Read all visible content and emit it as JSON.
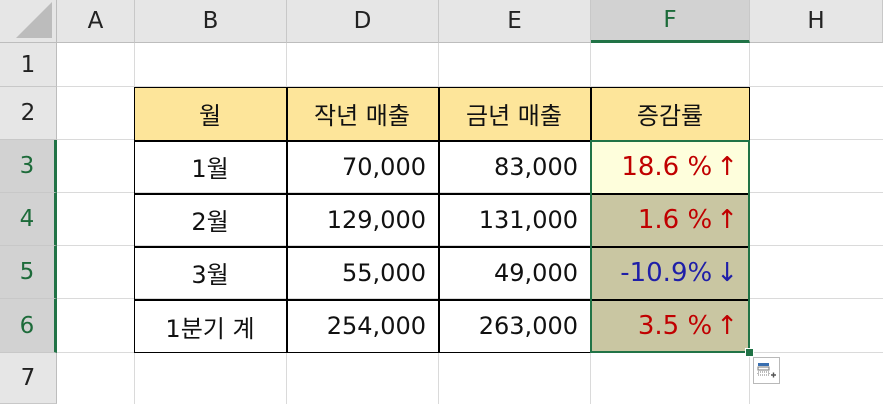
{
  "columns": [
    "A",
    "B",
    "D",
    "E",
    "F",
    "H"
  ],
  "rows": [
    "1",
    "2",
    "3",
    "4",
    "5",
    "6",
    "7"
  ],
  "table": {
    "headers": [
      "월",
      "작년 매출",
      "금년 매출",
      "증감률"
    ],
    "data": [
      {
        "month": "1월",
        "last_year": "70,000",
        "this_year": "83,000",
        "rate": "18.6 %",
        "arrow": "↑"
      },
      {
        "month": "2월",
        "last_year": "129,000",
        "this_year": "131,000",
        "rate": "1.6 %",
        "arrow": "↑"
      },
      {
        "month": "3월",
        "last_year": "55,000",
        "this_year": "49,000",
        "rate": "-10.9%",
        "arrow": "↓"
      },
      {
        "month": "1분기 계",
        "last_year": "254,000",
        "this_year": "263,000",
        "rate": "3.5 %",
        "arrow": "↑"
      }
    ]
  },
  "colors": {
    "header_fill": "#fde59a",
    "selection_fill": "#c9c6a2",
    "active_cell_fill": "#fefedc",
    "positive": "#c00000",
    "negative": "#1f1fa8",
    "selection_border": "#217346"
  },
  "icons": {
    "quick_analysis": "quick-analysis-icon"
  }
}
